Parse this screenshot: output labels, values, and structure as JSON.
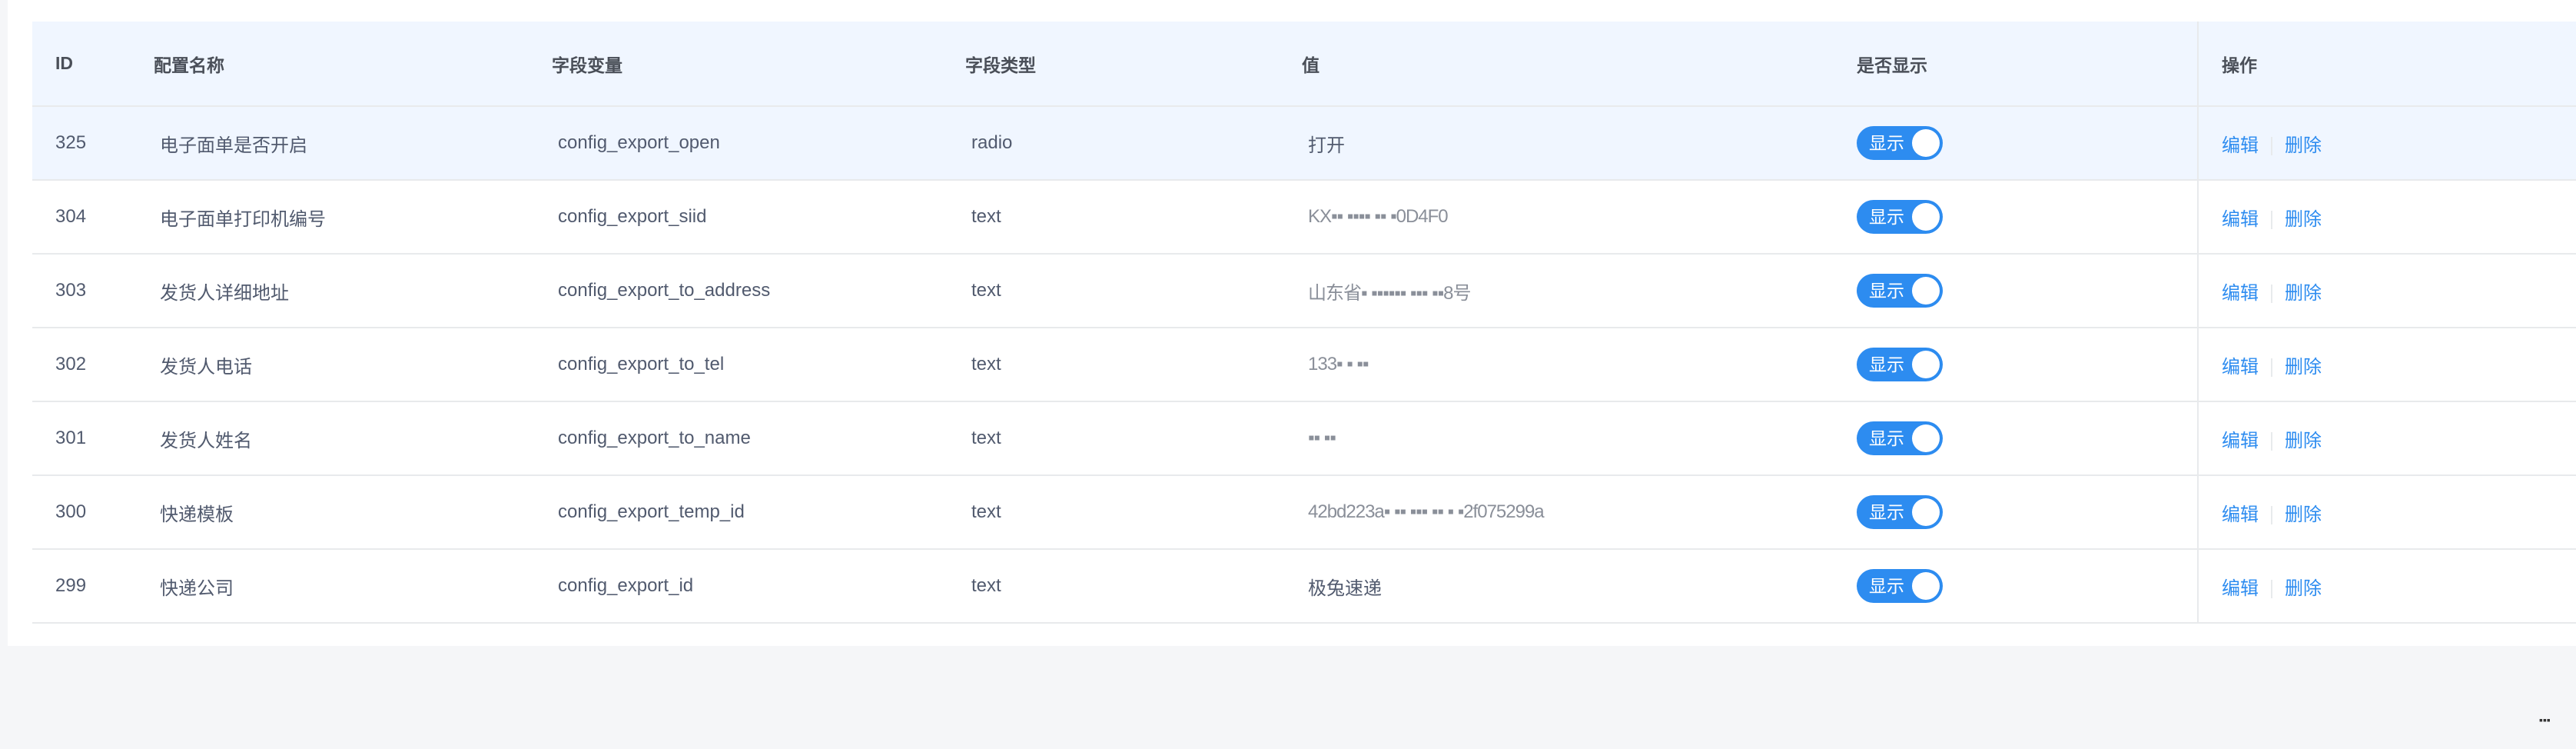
{
  "table": {
    "headers": {
      "id": "ID",
      "name": "配置名称",
      "var": "字段变量",
      "type": "字段类型",
      "value": "值",
      "show": "是否显示",
      "op": "操作"
    },
    "rows": [
      {
        "id": "325",
        "name": "电子面单是否开启",
        "var": "config_export_open",
        "type": "radio",
        "value": "打开",
        "switch_label": "显示",
        "edit": "编辑",
        "delete": "删除"
      },
      {
        "id": "304",
        "name": "电子面单打印机编号",
        "var": "config_export_siid",
        "type": "text",
        "value": "KX▪▪ ▪▪▪▪ ▪▪ ▪0D4F0",
        "switch_label": "显示",
        "edit": "编辑",
        "delete": "删除"
      },
      {
        "id": "303",
        "name": "发货人详细地址",
        "var": "config_export_to_address",
        "type": "text",
        "value": "山东省▪ ▪▪▪▪▪▪ ▪▪▪ ▪▪8号",
        "switch_label": "显示",
        "edit": "编辑",
        "delete": "删除"
      },
      {
        "id": "302",
        "name": "发货人电话",
        "var": "config_export_to_tel",
        "type": "text",
        "value": "133▪ ▪    ▪▪",
        "switch_label": "显示",
        "edit": "编辑",
        "delete": "删除"
      },
      {
        "id": "301",
        "name": "发货人姓名",
        "var": "config_export_to_name",
        "type": "text",
        "value": "▪▪ ▪▪",
        "switch_label": "显示",
        "edit": "编辑",
        "delete": "删除"
      },
      {
        "id": "300",
        "name": "快递模板",
        "var": "config_export_temp_id",
        "type": "text",
        "value": "42bd223a▪ ▪▪ ▪▪▪ ▪▪ ▪ ▪2f075299a",
        "switch_label": "显示",
        "edit": "编辑",
        "delete": "删除"
      },
      {
        "id": "299",
        "name": "快递公司",
        "var": "config_export_id",
        "type": "text",
        "value": "极兔速递",
        "switch_label": "显示",
        "edit": "编辑",
        "delete": "删除"
      }
    ]
  },
  "colors": {
    "accent": "#2d8cf0",
    "header_bg": "#f0f6ff",
    "border": "#e8eaec",
    "page_bg": "#f5f6f8"
  },
  "corner_mark": "▪▪▪"
}
